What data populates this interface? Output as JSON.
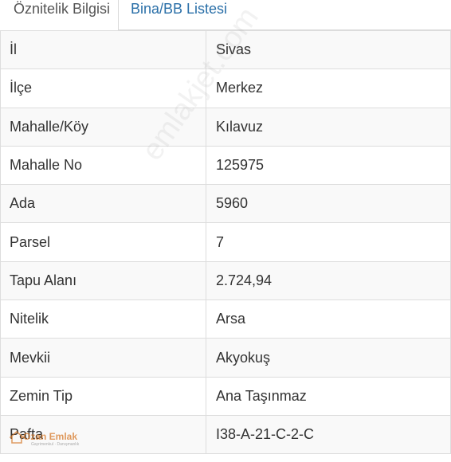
{
  "tabs": [
    {
      "label": "Öznitelik Bilgisi",
      "active": true
    },
    {
      "label": "Bina/BB Listesi",
      "active": false
    }
  ],
  "attributes": [
    {
      "key": "İl",
      "value": "Sivas"
    },
    {
      "key": "İlçe",
      "value": "Merkez"
    },
    {
      "key": "Mahalle/Köy",
      "value": "Kılavuz"
    },
    {
      "key": "Mahalle No",
      "value": "125975"
    },
    {
      "key": "Ada",
      "value": "5960"
    },
    {
      "key": "Parsel",
      "value": "7"
    },
    {
      "key": "Tapu Alanı",
      "value": "2.724,94"
    },
    {
      "key": "Nitelik",
      "value": "Arsa"
    },
    {
      "key": "Mevkii",
      "value": "Akyokuş"
    },
    {
      "key": "Zemin Tip",
      "value": "Ana Taşınmaz"
    },
    {
      "key": "Pafta",
      "value": "I38-A-21-C-2-C"
    }
  ],
  "watermark": "emlakjet.com",
  "logo": {
    "name": "Ozan Emlak",
    "tagline": "Gayrimenkul · Danışmanlık"
  },
  "colors": {
    "link": "#2a6fa8",
    "row_stripe": "#f9f9f9",
    "border": "#dddddd",
    "logo_accent": "#d67828"
  }
}
